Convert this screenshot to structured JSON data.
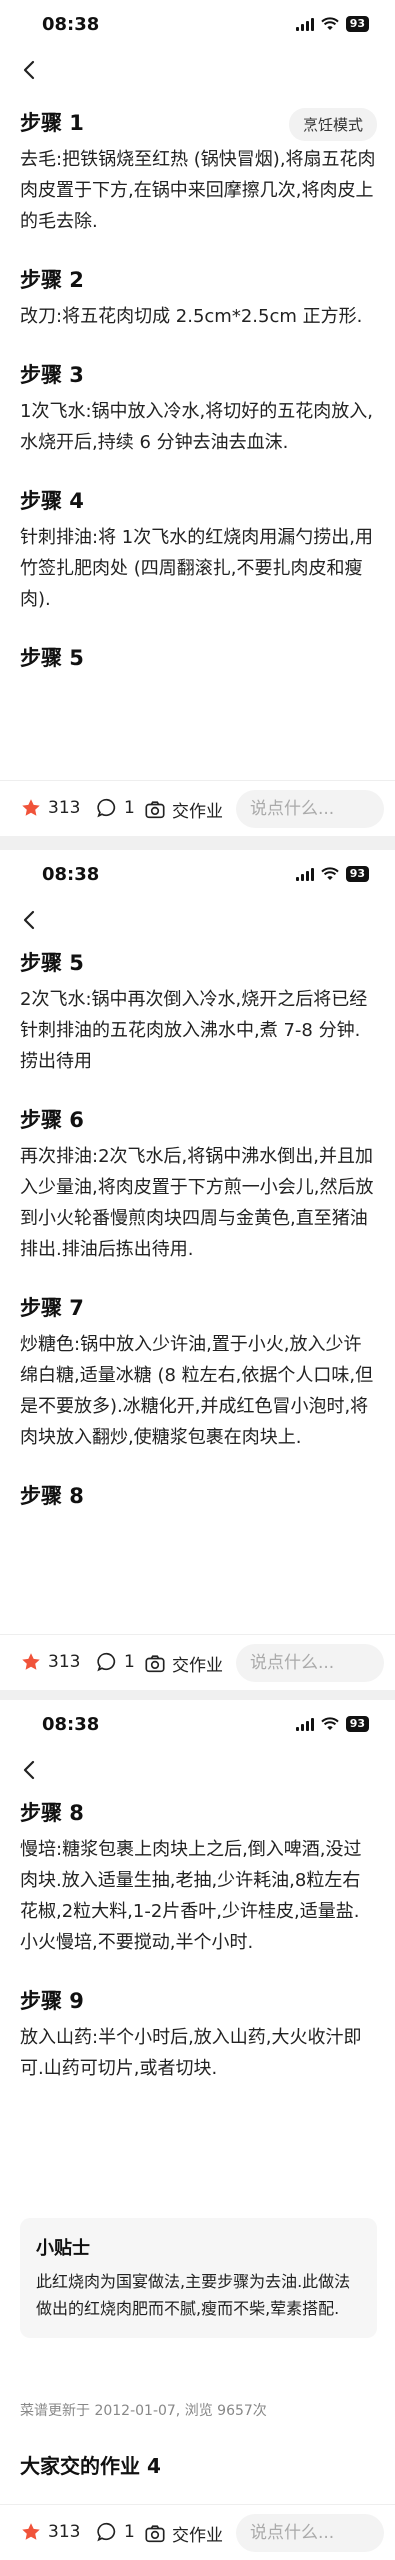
{
  "status": {
    "time": "08:38",
    "battery": "93"
  },
  "cook_mode_label": "烹饪模式",
  "screen1": {
    "steps": [
      {
        "title": "步骤 1",
        "text": "去毛:把铁锅烧至红热 (锅快冒烟),将扇五花肉肉皮置于下方,在锅中来回摩擦几次,将肉皮上的毛去除."
      },
      {
        "title": "步骤 2",
        "text": "改刀:将五花肉切成 2.5cm*2.5cm 正方形."
      },
      {
        "title": "步骤 3",
        "text": "1次飞水:锅中放入冷水,将切好的五花肉放入,水烧开后,持续 6 分钟去油去血沫."
      },
      {
        "title": "步骤 4",
        "text": "针刺排油:将 1次飞水的红烧肉用漏勺捞出,用竹签扎肥肉处 (四周翻滚扎,不要扎肉皮和瘦肉)."
      },
      {
        "title": "步骤 5",
        "text": ""
      }
    ]
  },
  "screen2": {
    "steps": [
      {
        "title": "步骤 5",
        "text": "2次飞水:锅中再次倒入冷水,烧开之后将已经针刺排油的五花肉放入沸水中,煮 7-8 分钟.捞出待用"
      },
      {
        "title": "步骤 6",
        "text": "再次排油:2次飞水后,将锅中沸水倒出,并且加入少量油,将肉皮置于下方煎一小会儿,然后放到小火轮番慢煎肉块四周与金黄色,直至猪油排出.排油后拣出待用."
      },
      {
        "title": "步骤 7",
        "text": "炒糖色:锅中放入少许油,置于小火,放入少许绵白糖,适量冰糖 (8 粒左右,依据个人口味,但是不要放多).冰糖化开,并成红色冒小泡时,将肉块放入翻炒,使糖浆包裹在肉块上."
      },
      {
        "title": "步骤 8",
        "text": ""
      }
    ]
  },
  "screen3": {
    "steps": [
      {
        "title": "步骤 8",
        "text": "慢培:糖浆包裹上肉块上之后,倒入啤酒,没过肉块.放入适量生抽,老抽,少许耗油,8粒左右花椒,2粒大料,1-2片香叶,少许桂皮,适量盐.小火慢培,不要搅动,半个小时."
      },
      {
        "title": "步骤 9",
        "text": "放入山药:半个小时后,放入山药,大火收汁即可.山药可切片,或者切块."
      }
    ],
    "tips_title": "小贴士",
    "tips_text": "此红烧肉为国宴做法,主要步骤为去油.此做法做出的红烧肉肥而不腻,瘦而不柴,荤素搭配.",
    "update_text": "菜谱更新于 2012-01-07, 浏览 9657次",
    "works_title": "大家交的作业 4"
  },
  "bottom_bar": {
    "likes": "313",
    "comments": "1",
    "homework_label": "交作业",
    "comment_placeholder": "说点什么..."
  },
  "colors": {
    "accent_red": "#f0533a"
  }
}
